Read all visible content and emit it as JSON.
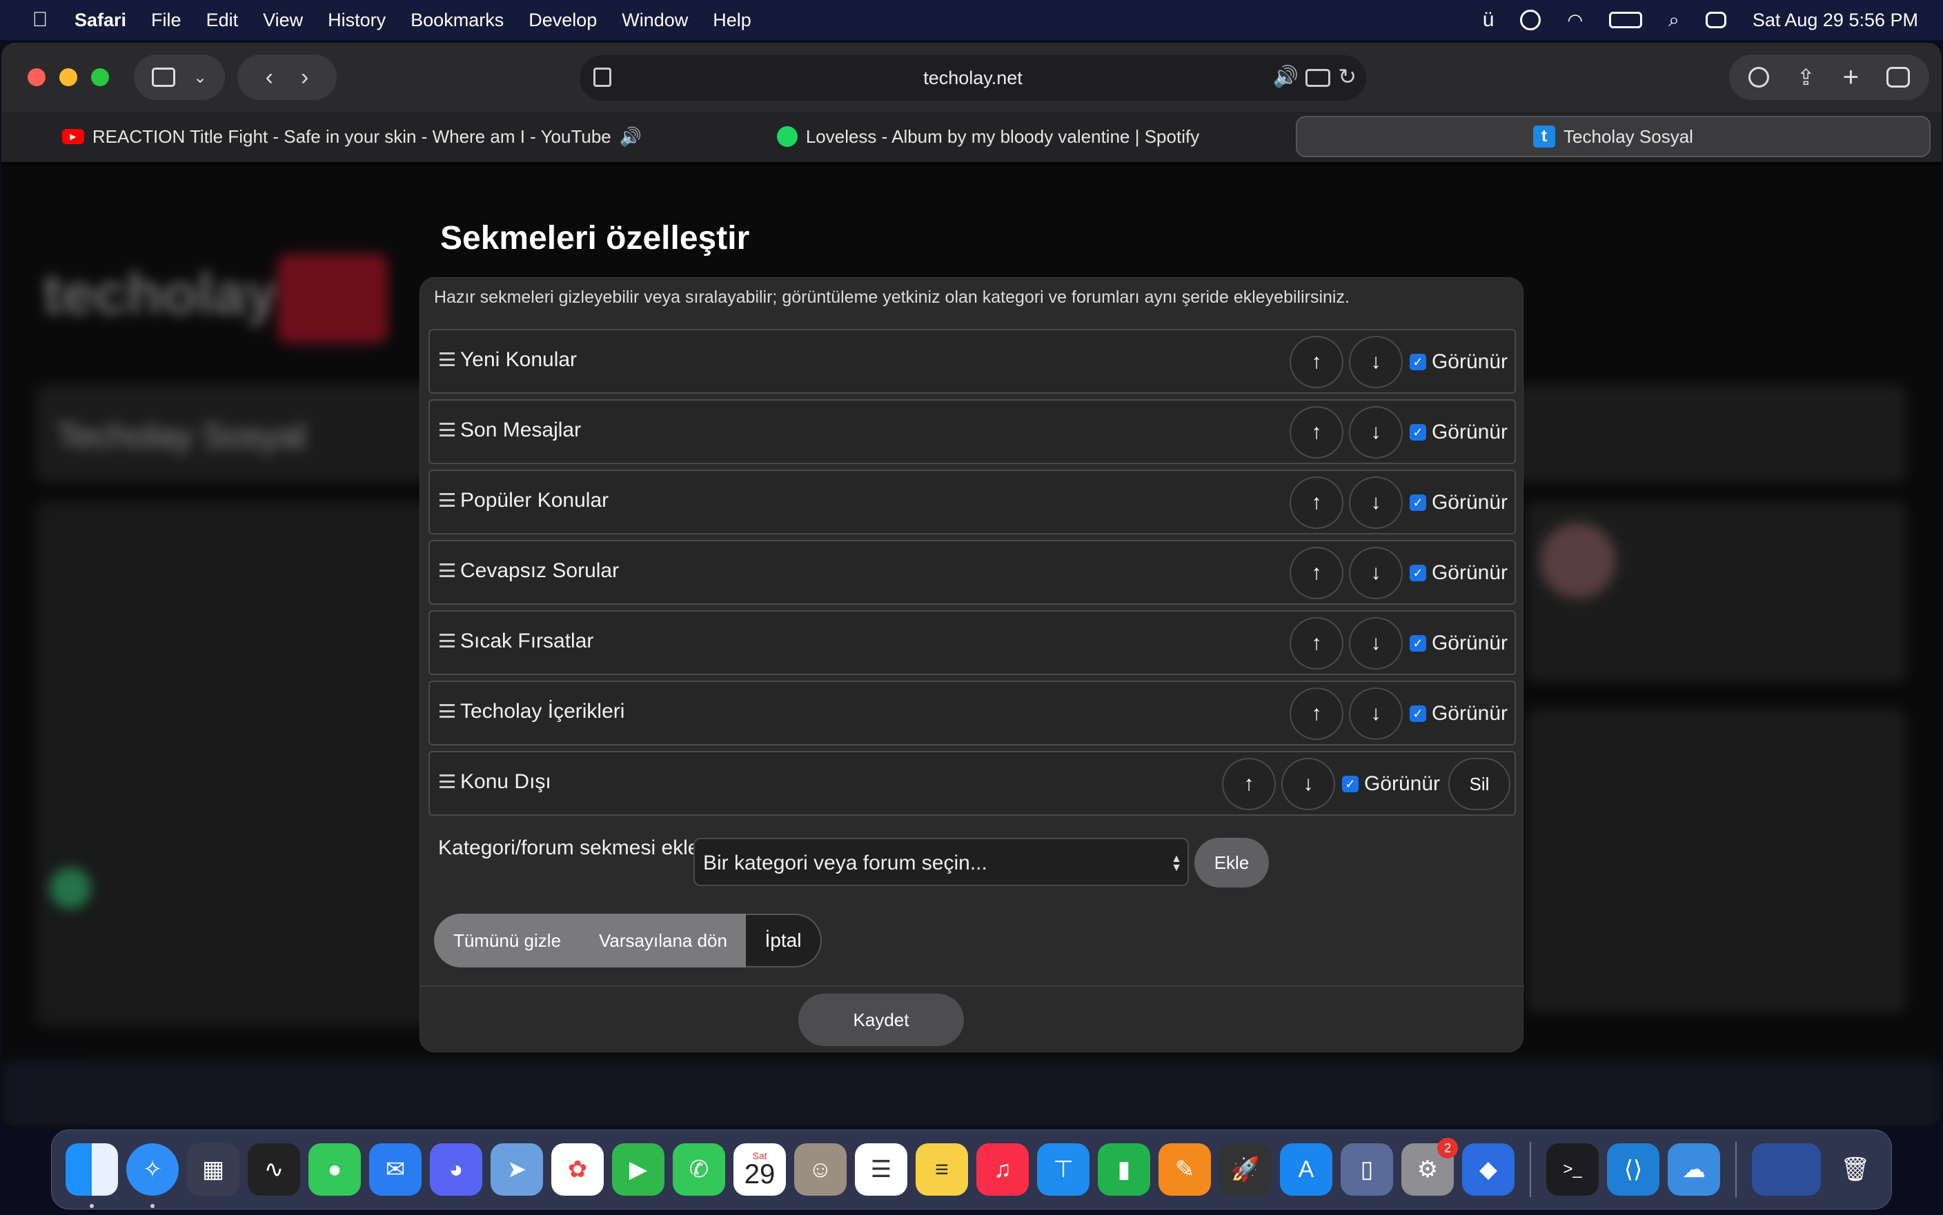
{
  "menubar": {
    "app": "Safari",
    "items": [
      "File",
      "Edit",
      "View",
      "History",
      "Bookmarks",
      "Develop",
      "Window",
      "Help"
    ],
    "datetime": "Sat Aug 29  5:56 PM",
    "status_icons": [
      "u-umlaut-icon",
      "play-circle-icon",
      "wifi-icon",
      "battery-charging-icon",
      "search-icon",
      "control-center-icon"
    ]
  },
  "browser": {
    "address": "techolay.net",
    "tabs": [
      {
        "title": "REACTION Title Fight - Safe in your skin - Where am I - YouTube"
      },
      {
        "title": "Loveless - Album by my bloody valentine | Spotify"
      },
      {
        "title": "Techolay Sosyal"
      }
    ]
  },
  "modal": {
    "title": "Sekmeleri özelleştir",
    "description": "Hazır sekmeleri gizleyebilir veya sıralayabilir; görüntüleme yetkiniz olan kategori ve forumları aynı şeride ekleyebilirsiniz.",
    "up_label": "↑",
    "down_label": "↓",
    "visible_label": "Görünür",
    "delete_label": "Sil",
    "rows": [
      {
        "label": "Yeni Konular"
      },
      {
        "label": "Son Mesajlar"
      },
      {
        "label": "Popüler Konular"
      },
      {
        "label": "Cevapsız Sorular"
      },
      {
        "label": "Sıcak Fırsatlar"
      },
      {
        "label": "Techolay İçerikleri"
      },
      {
        "label": "Konu Dışı"
      }
    ],
    "add_label": "Kategori/forum sekmesi ekle",
    "select_placeholder": "Bir kategori veya forum seçin...",
    "add_button": "Ekle",
    "hide_all": "Tümünü gizle",
    "reset_default": "Varsayılana dön",
    "cancel": "İptal",
    "save": "Kaydet"
  },
  "background": {
    "logo": "techolay",
    "site_title": "Techolay Sosyal"
  },
  "dock": {
    "calendar_month": "Sat",
    "calendar_day": "29",
    "settings_badge": "2"
  }
}
